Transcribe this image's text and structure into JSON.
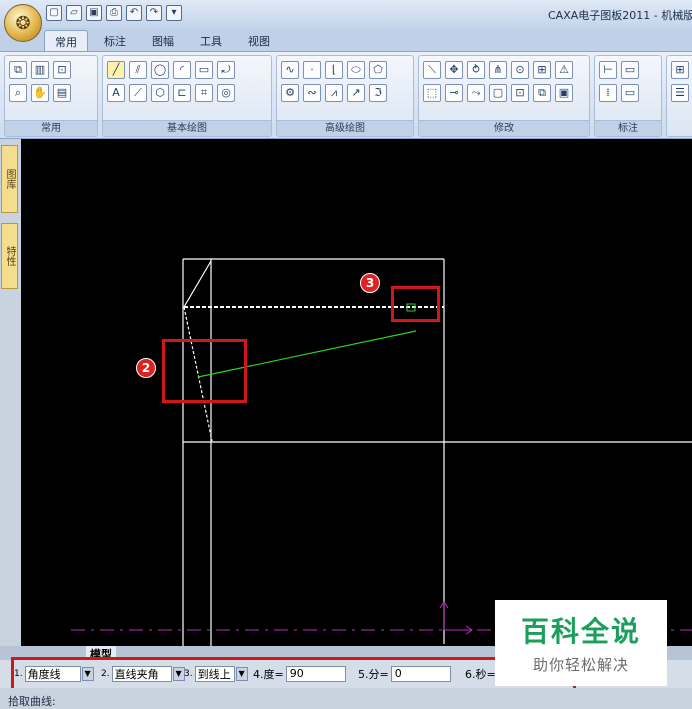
{
  "app": {
    "title": "CAXA电子图板2011 - 机械版"
  },
  "quick_access": [
    "new-icon",
    "open-icon",
    "save-icon",
    "print-icon",
    "undo-icon",
    "redo-icon",
    "customize-icon"
  ],
  "tabs": [
    {
      "label": "常用",
      "active": true
    },
    {
      "label": "标注",
      "active": false
    },
    {
      "label": "图幅",
      "active": false
    },
    {
      "label": "工具",
      "active": false
    },
    {
      "label": "视图",
      "active": false
    }
  ],
  "ribbon_groups": [
    {
      "label": "常用",
      "rows": [
        [
          "▭",
          "▥",
          "⊡"
        ],
        [
          "⌕",
          "⬚",
          "▤"
        ]
      ]
    },
    {
      "label": "基本绘图",
      "rows": [
        [
          "╱",
          "⫽",
          "◯",
          "◜",
          "▭",
          "⤾"
        ],
        [
          "A",
          "⟋",
          "⬡",
          "⊏",
          "⌗",
          "◎"
        ]
      ]
    },
    {
      "label": "高级绘图",
      "rows": [
        [
          "∿",
          "·",
          "⌊",
          "⬭",
          "⬠",
          "⌂"
        ],
        [
          "❀",
          "∾",
          "⩘",
          "↗",
          "∿",
          "⊟"
        ]
      ]
    },
    {
      "label": "修改",
      "rows": [
        [
          "⟍",
          "✥",
          "⥁",
          "⋔",
          "⊙",
          "⊞",
          "⚠"
        ],
        [
          "⬚",
          "⊸",
          "⤳",
          "▢",
          "⊡",
          "⧉",
          "▣"
        ]
      ]
    },
    {
      "label": "标注",
      "rows": [
        [
          "⊢",
          "▭"
        ],
        [
          "⁞",
          "▭"
        ]
      ]
    }
  ],
  "sidebar_tabs": [
    "图库",
    "特性"
  ],
  "markers": [
    "2",
    "3"
  ],
  "model_tab": "模型",
  "command_bar": {
    "field1": {
      "num": "1.",
      "value": "角度线"
    },
    "field2": {
      "num": "2.",
      "value": "直线夹角"
    },
    "field3": {
      "num": "3.",
      "value": "到线上"
    },
    "field4": {
      "label": "4.度=",
      "value": "90"
    },
    "field5": {
      "label": "5.分=",
      "value": "0"
    },
    "field6": {
      "label": "6.秒="
    }
  },
  "status_text": "拾取曲线:",
  "watermark": {
    "title": "百科全说",
    "subtitle": "助你轻松解决"
  },
  "colors": {
    "canvas_bg": "#000000",
    "line_white": "#ffffff",
    "line_green": "#27d427",
    "axis_magenta": "#c02ac0",
    "highlight_red": "#d01818"
  }
}
